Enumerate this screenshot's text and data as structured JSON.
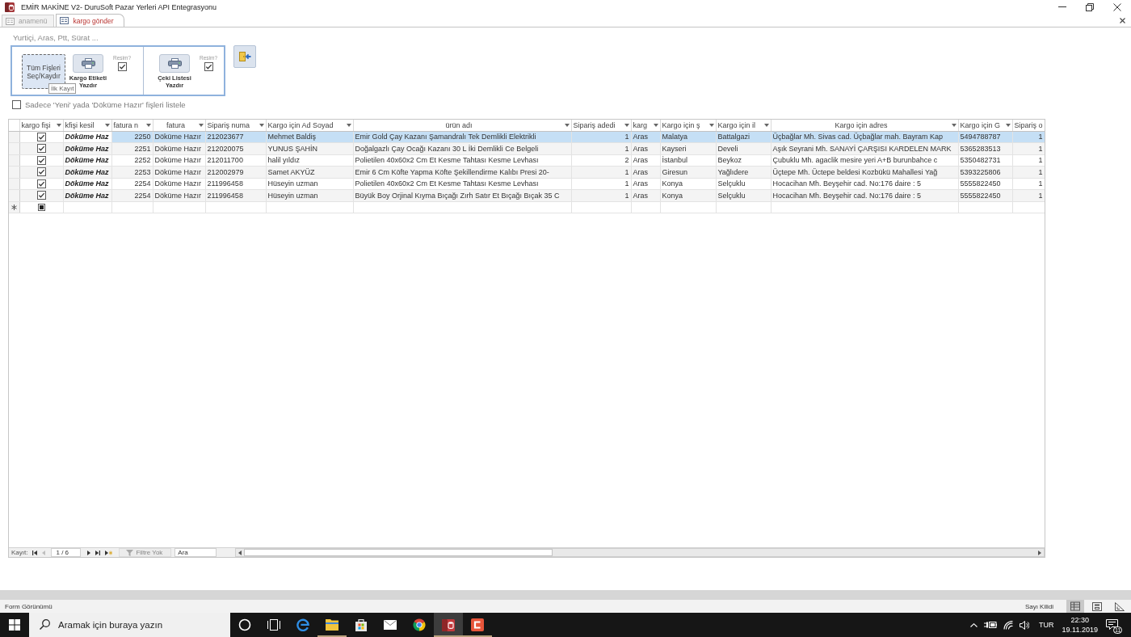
{
  "window": {
    "title": "EMİR MAKİNE V2- DuruSoft Pazar Yerleri API Entegrasyonu"
  },
  "tabs": [
    {
      "label": "anamenü",
      "selected": false
    },
    {
      "label": "kargo gönder",
      "selected": true
    }
  ],
  "form": {
    "caption": "Yurtiçi, Aras, Ptt, Sürat ...",
    "actions": [
      {
        "kind": "text",
        "label": "Tüm Fişleri Seç/Kaydır",
        "focused": true
      },
      {
        "kind": "print",
        "label": "Kargo Etiketi Yazdır",
        "option": {
          "label": "Resim?",
          "checked": true
        }
      },
      {
        "kind": "print",
        "label": "Çeki Listesi Yazdır",
        "option": {
          "label": "Resim?",
          "checked": true
        }
      }
    ],
    "tooltip": "İlk Kayıt",
    "list_filter": {
      "label": "Sadece 'Yeni' yada 'Döküme Hazır' fişleri listele",
      "checked": false
    }
  },
  "table": {
    "columns": [
      "kargo fişi",
      "kfişi kesil",
      "fatura n",
      "fatura",
      "Sipariş numa",
      "Kargo için Ad Soyad",
      "ürün adı",
      "Sipariş adedi",
      "karg",
      "Kargo için ş",
      "Kargo için il",
      "Kargo için adres",
      "Kargo için G",
      "Sipariş o"
    ],
    "rows": [
      {
        "kind": "record",
        "selected": true,
        "checked": true,
        "cells": [
          "Döküme Haz",
          "2250",
          "Döküme Hazır",
          "212023677",
          "Mehmet Baldiş",
          "Emir Gold Çay Kazanı Şamandralı Tek Demlikli Elektrikli",
          "1",
          "Aras",
          "Malatya",
          "Battalgazi",
          "Üçbağlar Mh. Sivas cad. Üçbağlar mah. Bayram Kap",
          "5494788787",
          "1"
        ]
      },
      {
        "kind": "record",
        "selected": false,
        "checked": true,
        "cells": [
          "Döküme Haz",
          "2251",
          "Döküme Hazır",
          "212020075",
          "YUNUS ŞAHİN",
          "Doğalgazlı Çay Ocağı Kazanı 30 L İki Demlikli Ce Belgeli",
          "1",
          "Aras",
          "Kayseri",
          "Develi",
          "Aşık Seyrani Mh. SANAYİ ÇARŞISI KARDELEN MARK",
          "5365283513",
          "1"
        ]
      },
      {
        "kind": "record",
        "selected": false,
        "checked": true,
        "cells": [
          "Döküme Haz",
          "2252",
          "Döküme Hazır",
          "212011700",
          "halil yıldız",
          "Polietilen 40x60x2 Cm Et Kesme Tahtası Kesme Levhası",
          "2",
          "Aras",
          "İstanbul",
          "Beykoz",
          "Çubuklu Mh. agaclik mesire yeri A+B burunbahce c",
          "5350482731",
          "1"
        ]
      },
      {
        "kind": "record",
        "selected": false,
        "checked": true,
        "cells": [
          "Döküme Haz",
          "2253",
          "Döküme Hazır",
          "212002979",
          "Samet AKYÜZ",
          "Emir 6 Cm Köfte Yapma Köfte Şekillendirme Kalıbı Presi 20-",
          "1",
          "Aras",
          "Giresun",
          "Yağlıdere",
          "Üçtepe Mh. Üctepe beldesi Kozbükü Mahallesi Yağ",
          "5393225806",
          "1"
        ]
      },
      {
        "kind": "record",
        "selected": false,
        "checked": true,
        "cells": [
          "Döküme Haz",
          "2254",
          "Döküme Hazır",
          "211996458",
          "Hüseyin uzman",
          "Polietilen 40x60x2 Cm Et Kesme Tahtası Kesme Levhası",
          "1",
          "Aras",
          "Konya",
          "Selçuklu",
          "Hocacihan Mh. Beyşehir cad. No:176 daire : 5",
          "5555822450",
          "1"
        ]
      },
      {
        "kind": "record",
        "selected": false,
        "checked": true,
        "cells": [
          "Döküme Haz",
          "2254",
          "Döküme Hazır",
          "211996458",
          "Hüseyin uzman",
          "Büyük Boy Orjinal Kıyma Bıçağı Zırh Satır Et Bıçağı Bıçak 35 C",
          "1",
          "Aras",
          "Konya",
          "Selçuklu",
          "Hocacihan Mh. Beyşehir cad. No:176 daire : 5",
          "5555822450",
          "1"
        ]
      },
      {
        "kind": "new",
        "selected": false
      }
    ]
  },
  "navigation": {
    "label": "Kayıt:",
    "back_buttons": [
      {
        "kind": "first",
        "disabled": false
      },
      {
        "kind": "previous",
        "disabled": true
      }
    ],
    "position": "1 / 6",
    "forward_buttons": [
      {
        "kind": "next",
        "disabled": false
      },
      {
        "kind": "last",
        "disabled": false
      },
      {
        "kind": "new",
        "disabled": false
      }
    ],
    "filter": {
      "label": "Filtre Yok",
      "disabled": true
    },
    "search": {
      "placeholder": "Ara"
    }
  },
  "status_bar": {
    "text": "Form Görünümü",
    "indicator": "Sayı Kilidi",
    "views": [
      {
        "kind": "form",
        "selected": true
      },
      {
        "kind": "layout",
        "selected": false
      },
      {
        "kind": "design",
        "selected": false
      }
    ]
  },
  "taskbar": {
    "search": {
      "placeholder": "Aramak için buraya yazın"
    },
    "apps": [
      {
        "kind": "circle",
        "running": false,
        "active": false
      },
      {
        "kind": "task_view",
        "running": false,
        "active": false
      },
      {
        "kind": "browser_e",
        "running": false,
        "active": false
      },
      {
        "kind": "folder",
        "running": true,
        "active": false
      },
      {
        "kind": "store",
        "running": false,
        "active": false
      },
      {
        "kind": "mail",
        "running": false,
        "active": false
      },
      {
        "kind": "browser_round",
        "running": false,
        "active": false
      },
      {
        "kind": "database",
        "running": true,
        "active": true
      },
      {
        "kind": "bracket",
        "running": true,
        "active": false
      }
    ],
    "language": "TUR",
    "time": "22:30",
    "date": "19.11.2019",
    "notifications": "11"
  }
}
